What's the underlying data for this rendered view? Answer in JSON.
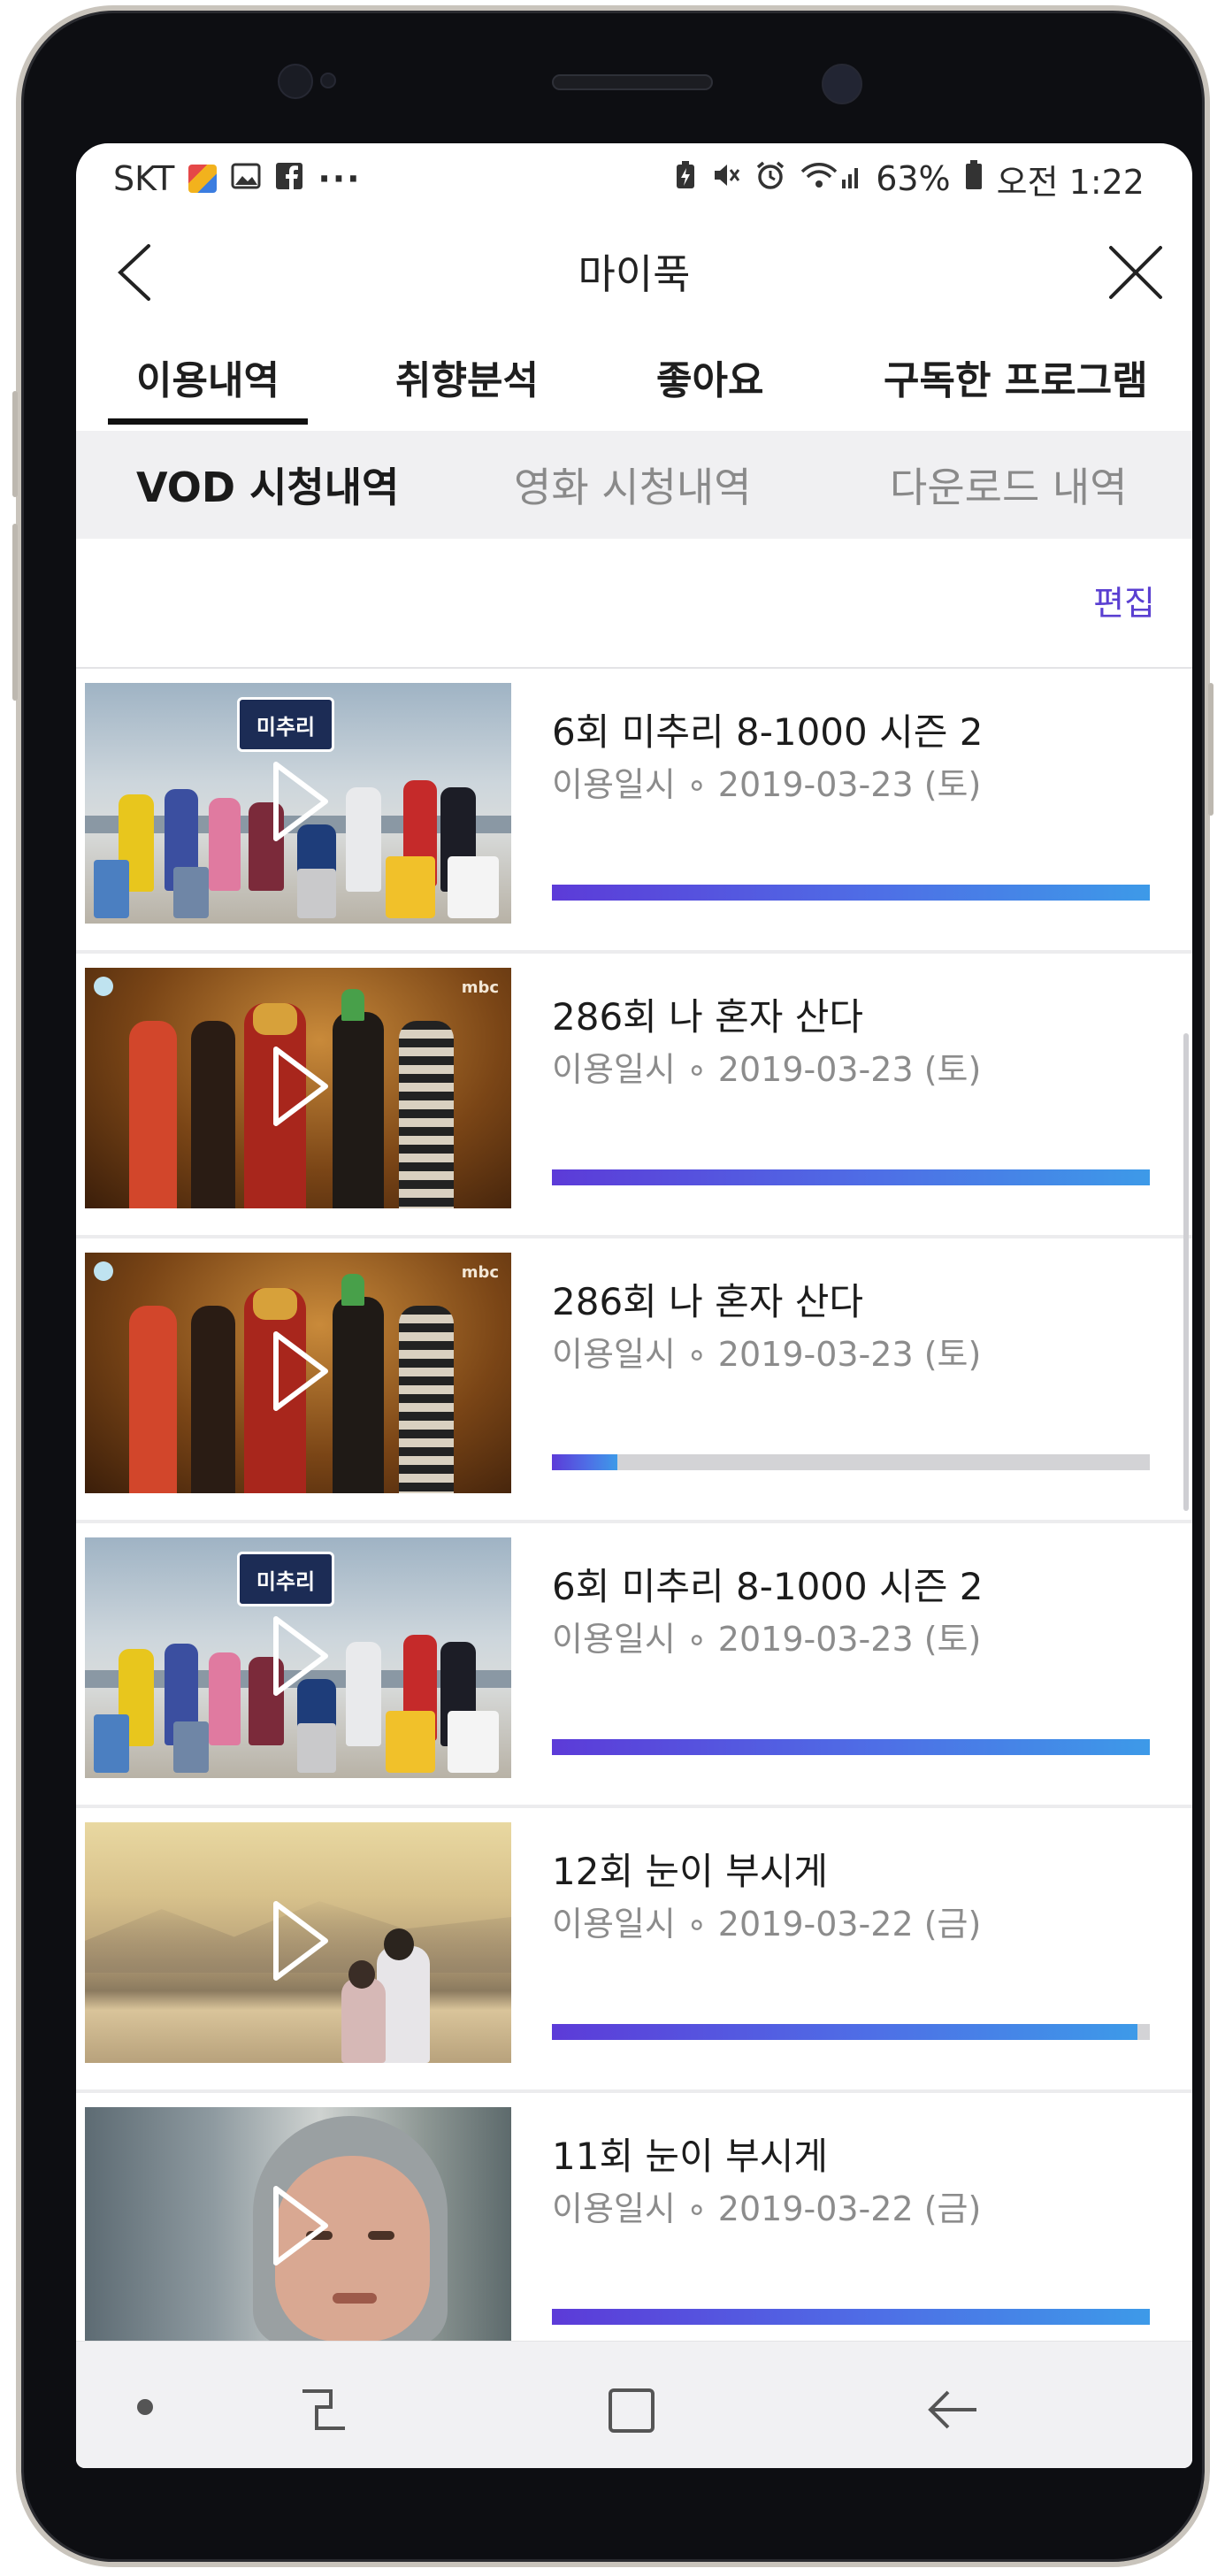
{
  "status_bar": {
    "carrier": "SKT",
    "overflow_dots": "···",
    "battery_percent": "63%",
    "time": "오전 1:22"
  },
  "app_bar": {
    "title": "마이푹"
  },
  "tabs": [
    {
      "label": "이용내역",
      "active": true
    },
    {
      "label": "취향분석",
      "active": false
    },
    {
      "label": "좋아요",
      "active": false
    },
    {
      "label": "구독한 프로그램",
      "active": false
    }
  ],
  "sub_tabs": [
    {
      "label": "VOD 시청내역",
      "active": true
    },
    {
      "label": "영화 시청내역",
      "active": false
    },
    {
      "label": "다운로드 내역",
      "active": false
    }
  ],
  "edit_label": "편집",
  "history": [
    {
      "title": "6회 미추리 8-1000 시즌 2",
      "date_label": "이용일시 ∘ 2019-03-23 (토)",
      "progress": 1.0,
      "thumb": "michuri",
      "thumb_caption": "미추리"
    },
    {
      "title": "286회 나 혼자 산다",
      "date_label": "이용일시 ∘ 2019-03-23 (토)",
      "progress": 1.0,
      "thumb": "nahonja",
      "thumb_caption": "mbc"
    },
    {
      "title": "286회 나 혼자 산다",
      "date_label": "이용일시 ∘ 2019-03-23 (토)",
      "progress": 0.11,
      "thumb": "nahonja",
      "thumb_caption": "mbc"
    },
    {
      "title": "6회 미추리 8-1000 시즌 2",
      "date_label": "이용일시 ∘ 2019-03-23 (토)",
      "progress": 1.0,
      "thumb": "michuri",
      "thumb_caption": "미추리"
    },
    {
      "title": "12회 눈이 부시게",
      "date_label": "이용일시 ∘ 2019-03-22 (금)",
      "progress": 0.98,
      "thumb": "sunset",
      "thumb_caption": ""
    },
    {
      "title": "11회 눈이 부시게",
      "date_label": "이용일시 ∘ 2019-03-22 (금)",
      "progress": 1.0,
      "thumb": "portrait",
      "thumb_caption": ""
    }
  ],
  "colors": {
    "accent": "#5a3fd1",
    "progress_start": "#5c3bd8",
    "progress_end": "#3d9ae8",
    "subtab_bg": "#f0f0f2"
  },
  "icons": [
    "back-arrow-icon",
    "close-icon",
    "play-icon",
    "nav-dot-icon",
    "recent-apps-icon",
    "home-icon",
    "nav-back-icon"
  ]
}
